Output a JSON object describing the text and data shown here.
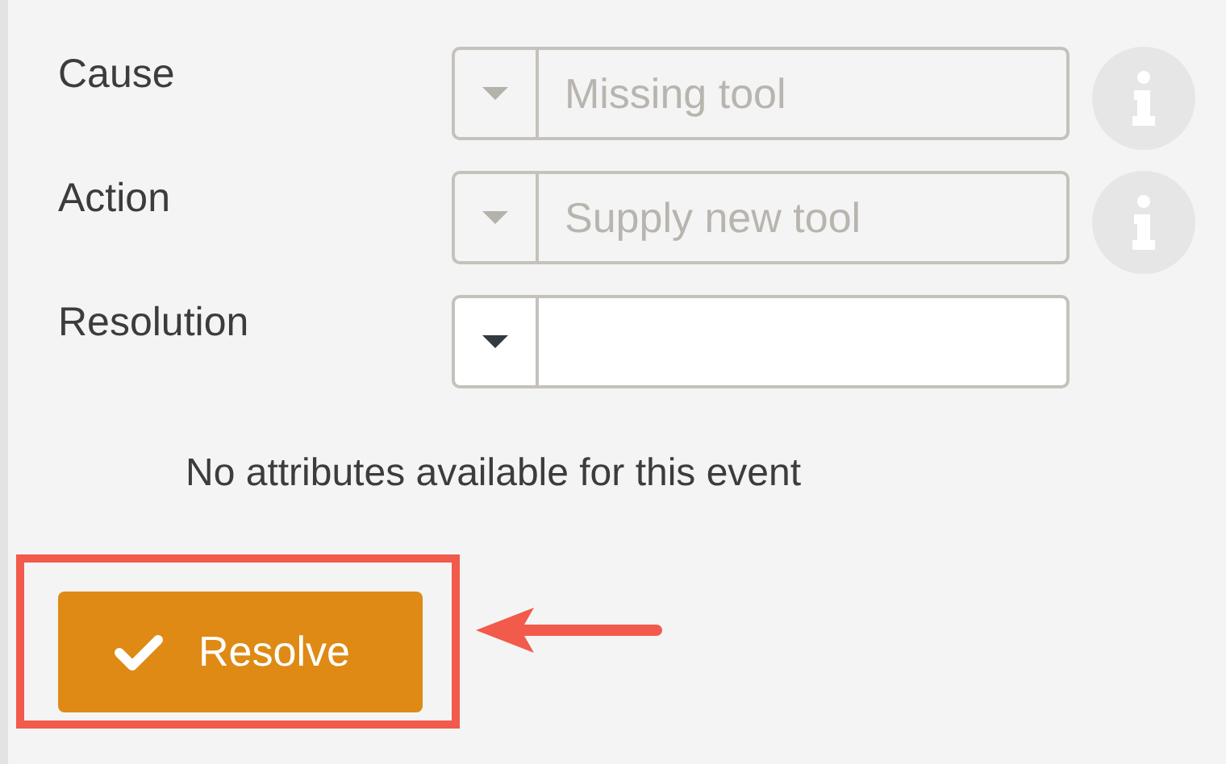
{
  "fields": [
    {
      "label": "Cause",
      "value": "Missing tool",
      "disabled": true,
      "info": true
    },
    {
      "label": "Action",
      "value": "Supply new tool",
      "disabled": true,
      "info": true
    },
    {
      "label": "Resolution",
      "disabled": false,
      "info": false
    }
  ],
  "message": "No attributes available for this event",
  "resolve_button": {
    "label": "Resolve"
  }
}
